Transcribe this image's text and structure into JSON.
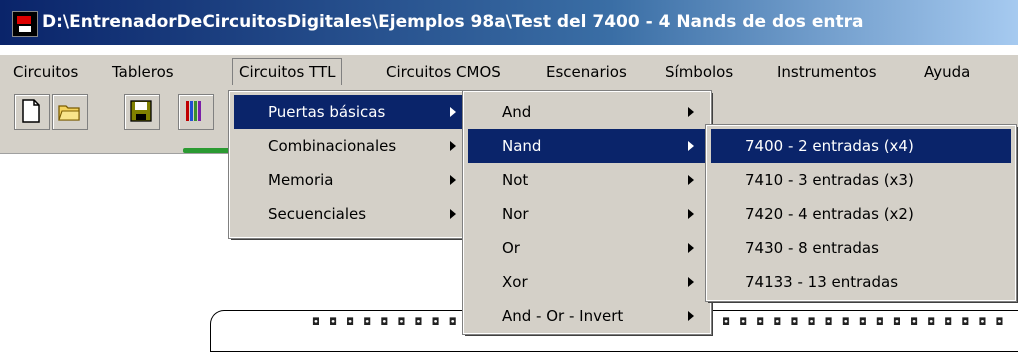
{
  "window": {
    "title": "D:\\EntrenadorDeCircuitosDigitales\\Ejemplos 98a\\Test del 7400 - 4 Nands de dos entra"
  },
  "menubar": [
    "Circuitos",
    "Tableros",
    "Circuitos TTL",
    "Circuitos CMOS",
    "Escenarios",
    "Símbolos",
    "Instrumentos",
    "Ayuda"
  ],
  "toolbar": {
    "icons": [
      "new-document-icon",
      "open-folder-icon",
      "save-icon",
      "bars-icon"
    ]
  },
  "menu_ttl": [
    "Puertas básicas",
    "Combinacionales",
    "Memoria",
    "Secuenciales"
  ],
  "menu_gates": [
    "And",
    "Nand",
    "Not",
    "Nor",
    "Or",
    "Xor",
    "And - Or - Invert"
  ],
  "menu_nand": [
    "7400  - 2 entradas (x4)",
    "7410  - 3 entradas (x3)",
    "7420  - 4 entradas (x2)",
    "7430  - 8 entradas",
    "74133 - 13 entradas"
  ],
  "chip": {
    "pins": "◘ ◘ ◘ ◘ ◘ ◘ ◘ ◘ ◘ ◘ ◘ ◘ ◘ ◘ ◘ ◘ ◘ ◘ ◘ ◘ ◘ ◘ ◘ ◘ ◘ ◘ ◘ ◘ ◘ ◘ ◘ ◘ ◘ ◘ ◘ ◘ ◘ ◘ ◘ ◘ ◘"
  }
}
